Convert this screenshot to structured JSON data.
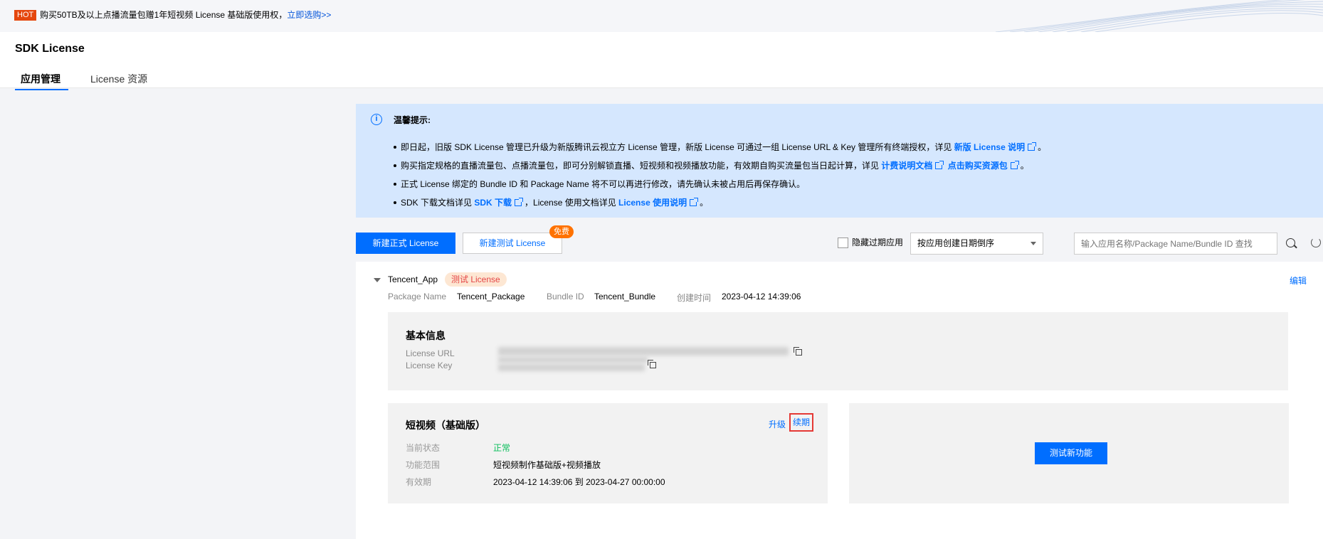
{
  "banner": {
    "hot_badge": "HOT",
    "message": "购买50TB及以上点播流量包赠1年短视频 License 基础版使用权，",
    "link": "立即选购>>"
  },
  "header": {
    "title": "SDK License",
    "tabs": [
      {
        "label": "应用管理",
        "active": true
      },
      {
        "label": "License 资源",
        "active": false
      }
    ]
  },
  "tips": {
    "title": "温馨提示:",
    "items": [
      {
        "text": "即日起，旧版 SDK License 管理已升级为新版腾讯云视立方 License 管理，新版 License 可通过一组 License URL & Key 管理所有终端授权，详见 ",
        "links": [
          "新版 License 说明"
        ],
        "suffix": "。"
      },
      {
        "text": "购买指定规格的直播流量包、点播流量包，即可分别解锁直播、短视频和视频播放功能，有效期自购买流量包当日起计算，详见 ",
        "links": [
          "计费说明文档",
          "点击购买资源包"
        ],
        "suffix": "。"
      },
      {
        "text": "正式 License 绑定的 Bundle ID 和 Package Name 将不可以再进行修改，请先确认未被占用后再保存确认。",
        "links": [],
        "suffix": ""
      },
      {
        "text": "SDK 下载文档详见 ",
        "links": [
          "SDK 下载"
        ],
        "middle": "，License 使用文档详见 ",
        "links2": [
          "License 使用说明"
        ],
        "suffix": "。"
      }
    ]
  },
  "toolbar": {
    "new_formal": "新建正式 License",
    "new_test": "新建测试 License",
    "free_badge": "免费",
    "hide_expired": "隐藏过期应用",
    "sort_select": "按应用创建日期倒序",
    "search_placeholder": "输入应用名称/Package Name/Bundle ID 查找"
  },
  "app": {
    "name": "Tencent_App",
    "tag": "测试 License",
    "edit": "编辑",
    "package_name_label": "Package Name",
    "package_name": "Tencent_Package",
    "bundle_id_label": "Bundle ID",
    "bundle_id": "Tencent_Bundle",
    "created_label": "创建时间",
    "created": "2023-04-12 14:39:06"
  },
  "basic_info": {
    "title": "基本信息",
    "license_url_label": "License URL",
    "license_key_label": "License Key"
  },
  "service": {
    "title": "短视频（基础版）",
    "upgrade": "升级",
    "renew": "续期",
    "status_label": "当前状态",
    "status": "正常",
    "scope_label": "功能范围",
    "scope": "短视频制作基础版+视频播放",
    "validity_label": "有效期",
    "validity": "2023-04-12 14:39:06 到 2023-04-27 00:00:00"
  },
  "test_panel": {
    "button": "测试新功能"
  },
  "colors": {
    "primary": "#006eff",
    "hot": "#e5470e",
    "tips_bg": "#d5e7fe",
    "status_ok": "#0abf5b",
    "free_badge": "#ff7200",
    "highlight_box": "#e53935"
  },
  "icons": [
    "info-icon",
    "external-link-icon",
    "chevron-down-icon",
    "search-icon",
    "refresh-icon",
    "copy-icon"
  ]
}
